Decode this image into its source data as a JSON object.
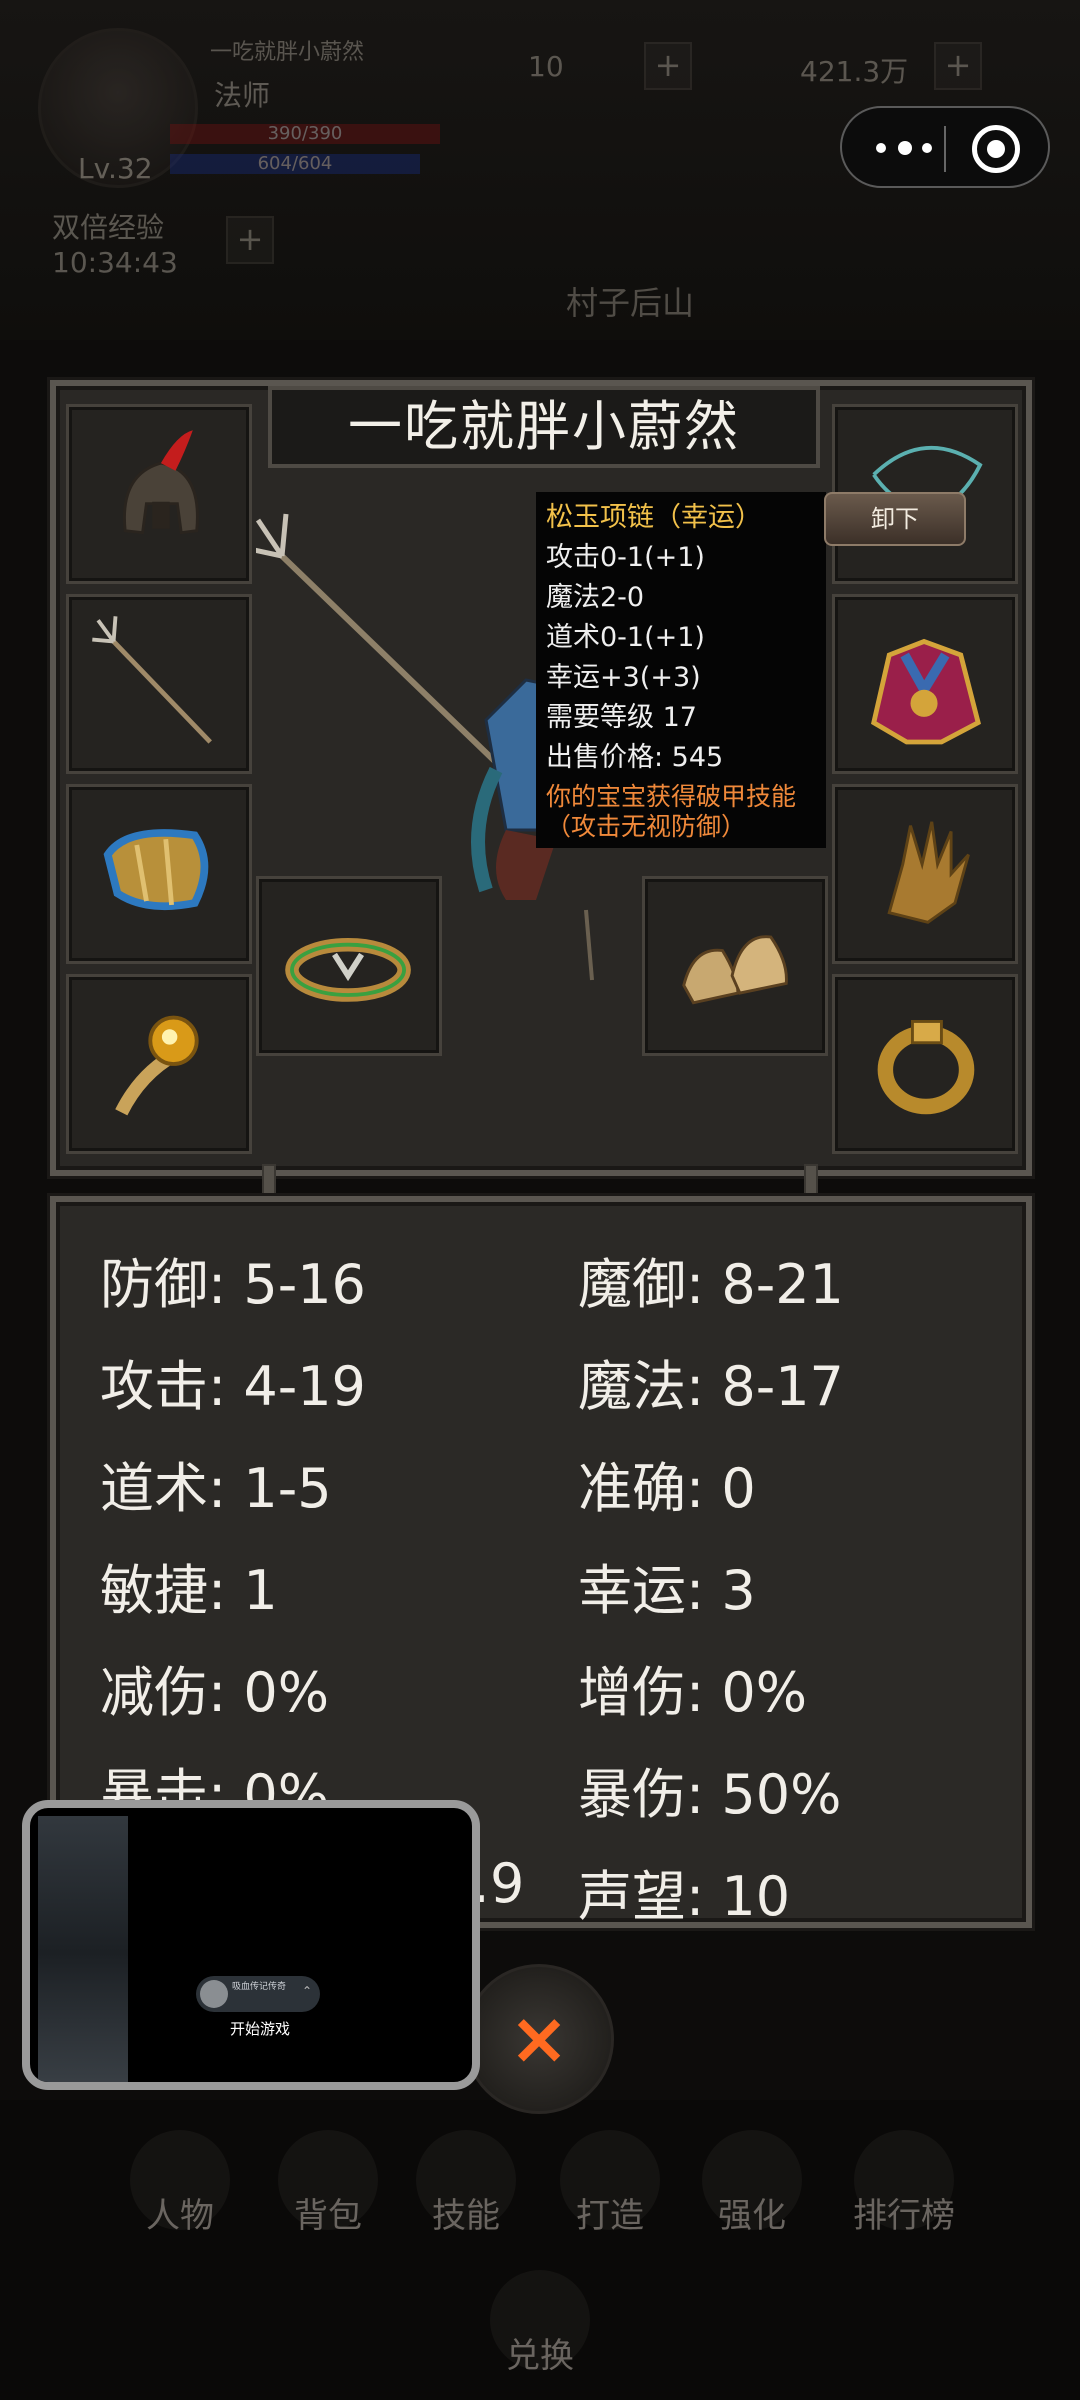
{
  "hud": {
    "player_name": "一吃就胖小蔚然",
    "class": "法师",
    "hp": "390/390",
    "mp": "604/604",
    "level": "Lv.32",
    "double_exp_label": "双倍经验",
    "timer": "10:34:43",
    "currency1": "10",
    "currency2": "421.3万",
    "map_name": "村子后山"
  },
  "equipment": {
    "title": "一吃就胖小蔚然",
    "slots": [
      "helmet-icon",
      "necklace-icon",
      "trident-icon",
      "armor-icon",
      "bracer-icon",
      "glove-icon",
      "ring-icon",
      "boots-icon",
      "amulet-icon",
      "ring-icon"
    ]
  },
  "tooltip": {
    "name": "松玉项链（幸运）",
    "attack": "攻击0-1(+1)",
    "magic": "魔法2-0",
    "taoism": "道术0-1(+1)",
    "luck": "幸运+3(+3)",
    "req_level": "需要等级 17",
    "sell_price": "出售价格: 545",
    "skill": "你的宝宝获得破甲技能（攻击无视防御）",
    "unequip_label": "卸下"
  },
  "stats": {
    "left": [
      "防御: 5-16",
      "攻击: 4-19",
      "道术: 1-5",
      "敏捷: 1",
      "减伤: 0%",
      "暴击: 0%",
      "…9"
    ],
    "right": [
      "魔御: 8-21",
      "魔法: 8-17",
      "准确: 0",
      "幸运: 3",
      "增伤: 0%",
      "暴伤: 50%",
      "声望: 10"
    ]
  },
  "nav": [
    "人物",
    "背包",
    "技能",
    "打造",
    "强化",
    "排行榜"
  ],
  "exchange_label": "兑换",
  "close_label": "×",
  "floating_window": {
    "user_text": "吸血传记传奇",
    "start_label": "开始游戏"
  },
  "colors": {
    "tooltip_name": "#f2c14a",
    "tooltip_skill": "#f0893a",
    "close": "#ff6a20"
  }
}
